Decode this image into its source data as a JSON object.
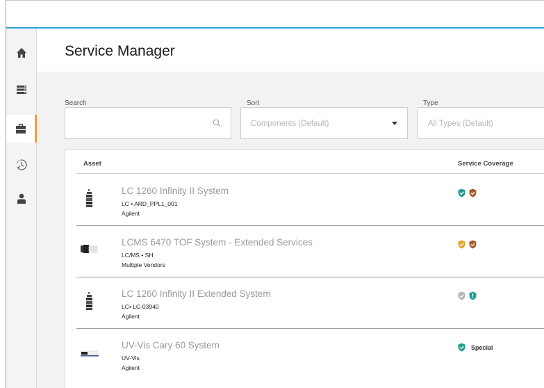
{
  "page": {
    "title": "Service Manager"
  },
  "sidebar": {
    "items": [
      {
        "icon": "home-icon",
        "active": false
      },
      {
        "icon": "list-icon",
        "active": false
      },
      {
        "icon": "briefcase-icon",
        "active": true
      },
      {
        "icon": "history-icon",
        "active": false
      },
      {
        "icon": "user-icon",
        "active": false
      }
    ]
  },
  "filters": {
    "search": {
      "label": "Search",
      "placeholder": ""
    },
    "sort": {
      "label": "Sort",
      "value": "Components (Default)"
    },
    "type": {
      "label": "Type",
      "value": "All Types (Default)"
    }
  },
  "table": {
    "columns": [
      "Asset",
      "Service Coverage"
    ],
    "rows": [
      {
        "name": "LC 1260 Infinity II System",
        "line1": "LC • ARD_PPL1_001",
        "line2": "Agilent",
        "thumb": "tower",
        "coverage": [
          {
            "color": "#1f9e8f",
            "mark": "check"
          },
          {
            "color": "#a55a2a",
            "mark": "check"
          }
        ],
        "coverage_label": ""
      },
      {
        "name": "LCMS 6470 TOF System - Extended Services",
        "line1": "LC/MS • SH",
        "line2": "Multiple Vendors",
        "thumb": "lcms",
        "coverage": [
          {
            "color": "#e3a526",
            "mark": "check"
          },
          {
            "color": "#a55a2a",
            "mark": "check"
          }
        ],
        "coverage_label": ""
      },
      {
        "name": "LC 1260 Infinity II Extended System",
        "line1": "LC• LC-03940",
        "line2": "Agilent",
        "thumb": "tower",
        "coverage": [
          {
            "color": "#b5b5b5",
            "mark": "check"
          },
          {
            "color": "#1f9e8f",
            "mark": "exclaim"
          }
        ],
        "coverage_label": ""
      },
      {
        "name": "UV-Vis Cary 60 System",
        "line1": "UV-Vis",
        "line2": "Agilent",
        "thumb": "uvvis",
        "coverage": [
          {
            "color": "#1f9e8f",
            "mark": "check"
          }
        ],
        "coverage_label": "Special"
      }
    ]
  },
  "colors": {
    "accent": "#2a9fd6",
    "active_marker": "#f0a030"
  }
}
